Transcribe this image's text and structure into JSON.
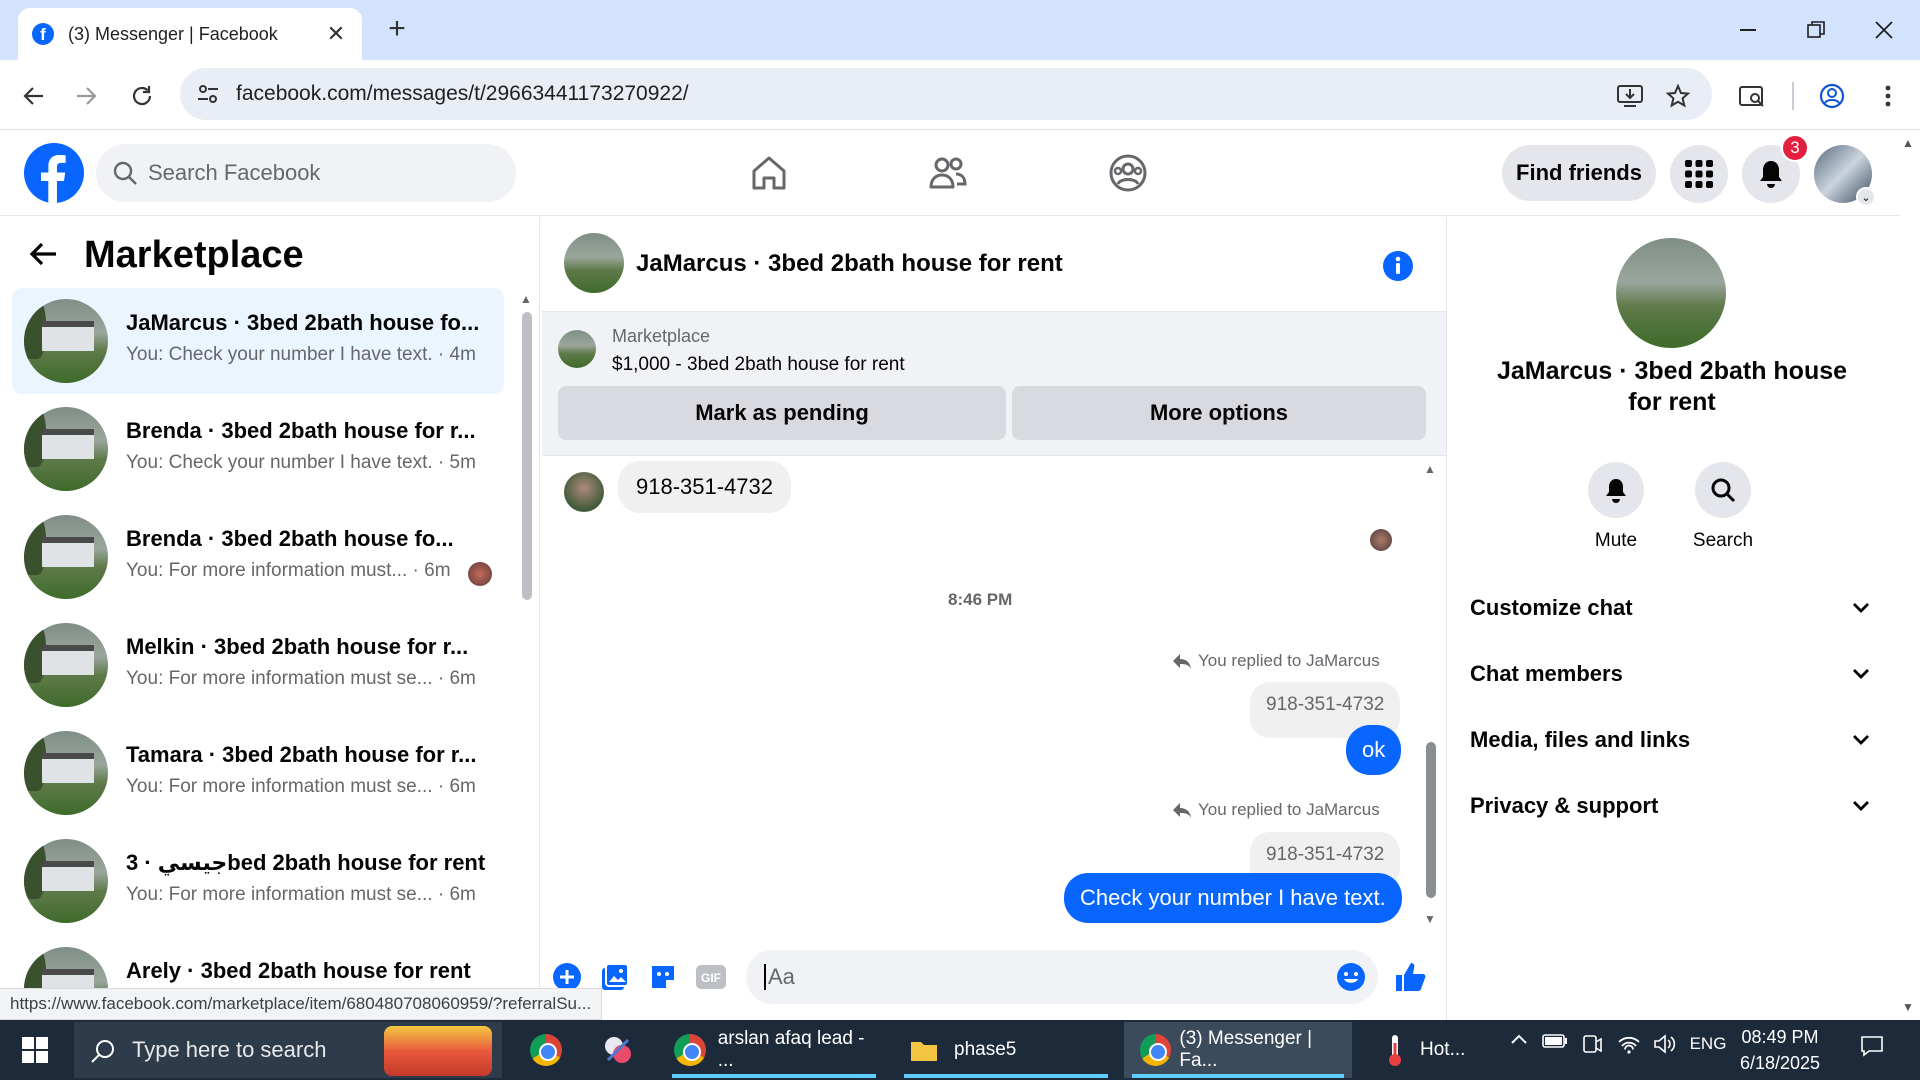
{
  "browser": {
    "tab_title": "(3) Messenger | Facebook",
    "address": "facebook.com/messages/t/29663441173270922/",
    "status_url": "https://www.facebook.com/marketplace/item/680480708060959/?referralSu..."
  },
  "fb": {
    "search_placeholder": "Search Facebook",
    "find_friends": "Find friends",
    "notification_count": "3"
  },
  "left": {
    "title": "Marketplace",
    "conversations": [
      {
        "name": "JaMarcus · 3bed 2bath house fo...",
        "preview": "You: Check your number I have text. · 4m",
        "active": true
      },
      {
        "name": "Brenda · 3bed 2bath house for r...",
        "preview": "You: Check your number I have text. · 5m"
      },
      {
        "name": "Brenda · 3bed 2bath house fo...",
        "preview": "You: For more information must... · 6m"
      },
      {
        "name": "Melkin · 3bed 2bath house for r...",
        "preview": "You: For more information must se... · 6m"
      },
      {
        "name": "Tamara · 3bed 2bath house for r...",
        "preview": "You: For more information must se... · 6m"
      },
      {
        "name": "جيسي · 3bed 2bath house for rent",
        "preview": "You: For more information must se... · 6m"
      },
      {
        "name": "Arely · 3bed 2bath house for rent",
        "preview": ""
      }
    ]
  },
  "chat": {
    "title": "JaMarcus · 3bed 2bath house for rent",
    "marketplace_label": "Marketplace",
    "listing": "$1,000 - 3bed 2bath house for rent",
    "mark_pending": "Mark as pending",
    "more_options": "More options",
    "incoming_msg": "918-351-4732",
    "timestamp": "8:46 PM",
    "reply1_label": "You replied to JaMarcus",
    "reply1_quote": "918-351-4732",
    "reply1_msg": "ok",
    "reply2_label": "You replied to JaMarcus",
    "reply2_quote": "918-351-4732",
    "reply2_msg": "Check your number I have text.",
    "composer_placeholder": "Aa"
  },
  "right": {
    "title": "JaMarcus · 3bed 2bath house for rent",
    "mute": "Mute",
    "search": "Search",
    "sections": [
      "Customize chat",
      "Chat members",
      "Media, files and links",
      "Privacy & support"
    ]
  },
  "taskbar": {
    "search_placeholder": "Type here to search",
    "app1": "arslan afaq lead - ...",
    "app2": "phase5",
    "app3": "(3) Messenger | Fa...",
    "weather": "Hot...",
    "lang": "ENG",
    "time": "08:49 PM",
    "date": "6/18/2025"
  },
  "colors": {
    "fb_blue": "#0866ff",
    "tabbar": "#d3e3fd",
    "taskbar": "#1c2a3a",
    "badge_red": "#e41e3f"
  }
}
